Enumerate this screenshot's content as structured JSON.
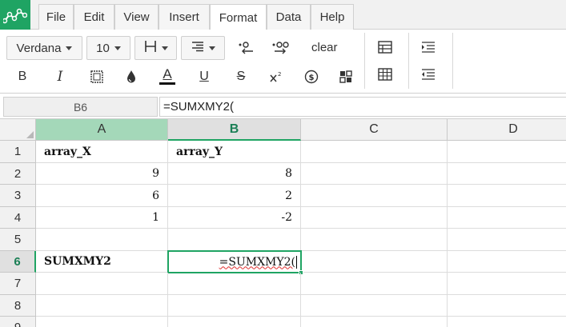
{
  "menubar": {
    "items": [
      "File",
      "Edit",
      "View",
      "Insert",
      "Format",
      "Data",
      "Help"
    ],
    "active": "Format"
  },
  "toolbar": {
    "font_family": "Verdana",
    "font_size": "10",
    "clear_label": "clear",
    "icons": [
      "borders-icon",
      "align-icon",
      "decrease-decimal-icon",
      "increase-decimal-icon",
      "bold-icon",
      "italic-icon",
      "format-cells-icon",
      "fill-color-icon",
      "text-color-icon",
      "underline-icon",
      "strikethrough-icon",
      "superscript-icon",
      "currency-icon",
      "styles-icon",
      "table-icon",
      "table-grid-icon",
      "indent-icon",
      "outdent-icon"
    ],
    "bold_glyph": "B",
    "italic_glyph": "I",
    "text_color_glyph": "A",
    "underline_glyph": "U",
    "strike_glyph": "S",
    "accent": "#1fa463"
  },
  "formula_bar": {
    "cell_ref": "B6",
    "formula": "=SUMXMY2("
  },
  "grid": {
    "columns": [
      "A",
      "B",
      "C",
      "D"
    ],
    "rows": [
      "1",
      "2",
      "3",
      "4",
      "5",
      "6",
      "7",
      "8",
      "9"
    ],
    "cells": {
      "A1": "array_X",
      "B1": "array_Y",
      "A2": "9",
      "B2": "8",
      "A3": "6",
      "B3": "2",
      "A4": "1",
      "B4": "-2",
      "A6": "SUMXMY2",
      "B6": "=SUMXMY2("
    }
  }
}
